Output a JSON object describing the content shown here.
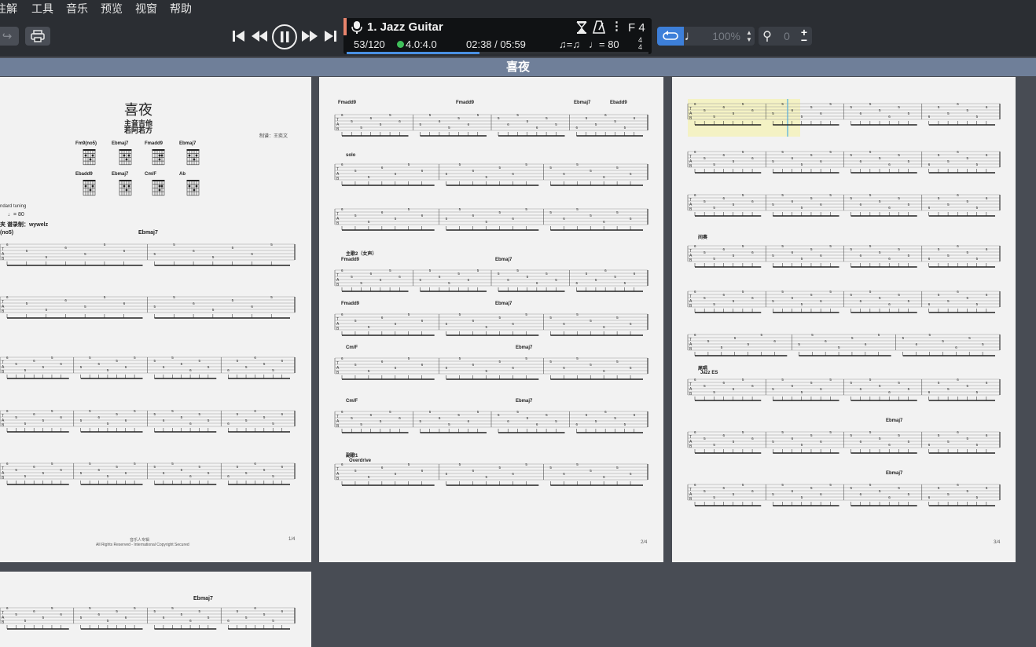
{
  "menu": [
    "注解",
    "工具",
    "音乐",
    "预览",
    "视窗",
    "帮助"
  ],
  "toolbar": {
    "track_title": "1. Jazz Guitar",
    "bar_position": "53/120",
    "signature": "4.0:4.0",
    "time": "02:38 / 05:59",
    "tempo": "♩= 80",
    "swing": "♫=♫",
    "key": "F 4",
    "time_sig": "4/4",
    "volume_pct": "100%",
    "transpose": "0",
    "playback_progress": 0.44
  },
  "score_title": "喜夜",
  "page1": {
    "title": "喜夜",
    "subtitle1": "主音吉他",
    "subtitle2": "若阿若方",
    "credit": "制谱：王奕文",
    "chords_row1": [
      "Fm9(no5)",
      "Ebmaj7",
      "Fmadd9",
      "Ebmaj7"
    ],
    "chords_row2": [
      "Ebadd9",
      "Ebmaj7",
      "Cm/F",
      "Ab"
    ],
    "tuning": "ndard tuning",
    "tempo": "♩= 80",
    "arranger": "夹 谱录制：wywelz",
    "section_intro": "(no5)",
    "chord_ebmaj7": "Ebmaj7",
    "footer_center": "音乐人专辑",
    "footer_copy": "All Rights Reserved - International Copyright Secured",
    "page_no": "1/4"
  },
  "page2": {
    "labels": [
      "Fmadd9",
      "Fmadd9",
      "Ebmaj7",
      "Ebadd9",
      "solo",
      "主歌2（女声）",
      "Fmadd9",
      "Ebmaj7",
      "Fmadd9",
      "Ebmaj7",
      "Cm/F",
      "Ebmaj7",
      "Cm/F",
      "Ebmaj7",
      "副歌1",
      "Overdrive"
    ],
    "page_no": "2/4"
  },
  "page3": {
    "labels": [
      "间奏",
      "尾唱",
      "Jazz ES",
      "Ebmaj7",
      "Ebmaj7"
    ],
    "page_no": "3/4"
  },
  "page4": {
    "label": "Ebmaj7"
  }
}
